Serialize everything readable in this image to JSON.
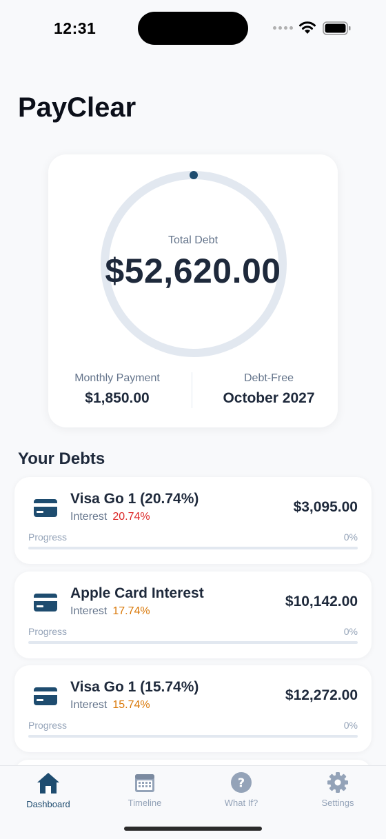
{
  "status": {
    "time": "12:31"
  },
  "app": {
    "title": "PayClear"
  },
  "summary": {
    "total_label": "Total Debt",
    "total_value": "$52,620.00",
    "monthly_label": "Monthly Payment",
    "monthly_value": "$1,850.00",
    "debtfree_label": "Debt-Free",
    "debtfree_value": "October 2027",
    "ring_progress": 0
  },
  "debts_section": {
    "title": "Your Debts"
  },
  "debts": [
    {
      "name": "Visa Go 1 (20.74%)",
      "interest_label": "Interest",
      "rate": "20.74%",
      "rate_color": "#dc2626",
      "balance": "$3,095.00",
      "progress_label": "Progress",
      "progress_pct": "0%",
      "progress": 0
    },
    {
      "name": "Apple Card Interest",
      "interest_label": "Interest",
      "rate": "17.74%",
      "rate_color": "#d97706",
      "balance": "$10,142.00",
      "progress_label": "Progress",
      "progress_pct": "0%",
      "progress": 0
    },
    {
      "name": "Visa Go 1 (15.74%)",
      "interest_label": "Interest",
      "rate": "15.74%",
      "rate_color": "#d97706",
      "balance": "$12,272.00",
      "progress_label": "Progress",
      "progress_pct": "0%",
      "progress": 0
    }
  ],
  "tabs": [
    {
      "label": "Dashboard",
      "icon": "house-icon",
      "active": true
    },
    {
      "label": "Timeline",
      "icon": "calendar-icon",
      "active": false
    },
    {
      "label": "What If?",
      "icon": "question-circle-icon",
      "active": false
    },
    {
      "label": "Settings",
      "icon": "gear-icon",
      "active": false
    }
  ],
  "colors": {
    "accent": "#1e4c6f",
    "ring": "#e2e8f0",
    "background": "#f8f9fb"
  }
}
